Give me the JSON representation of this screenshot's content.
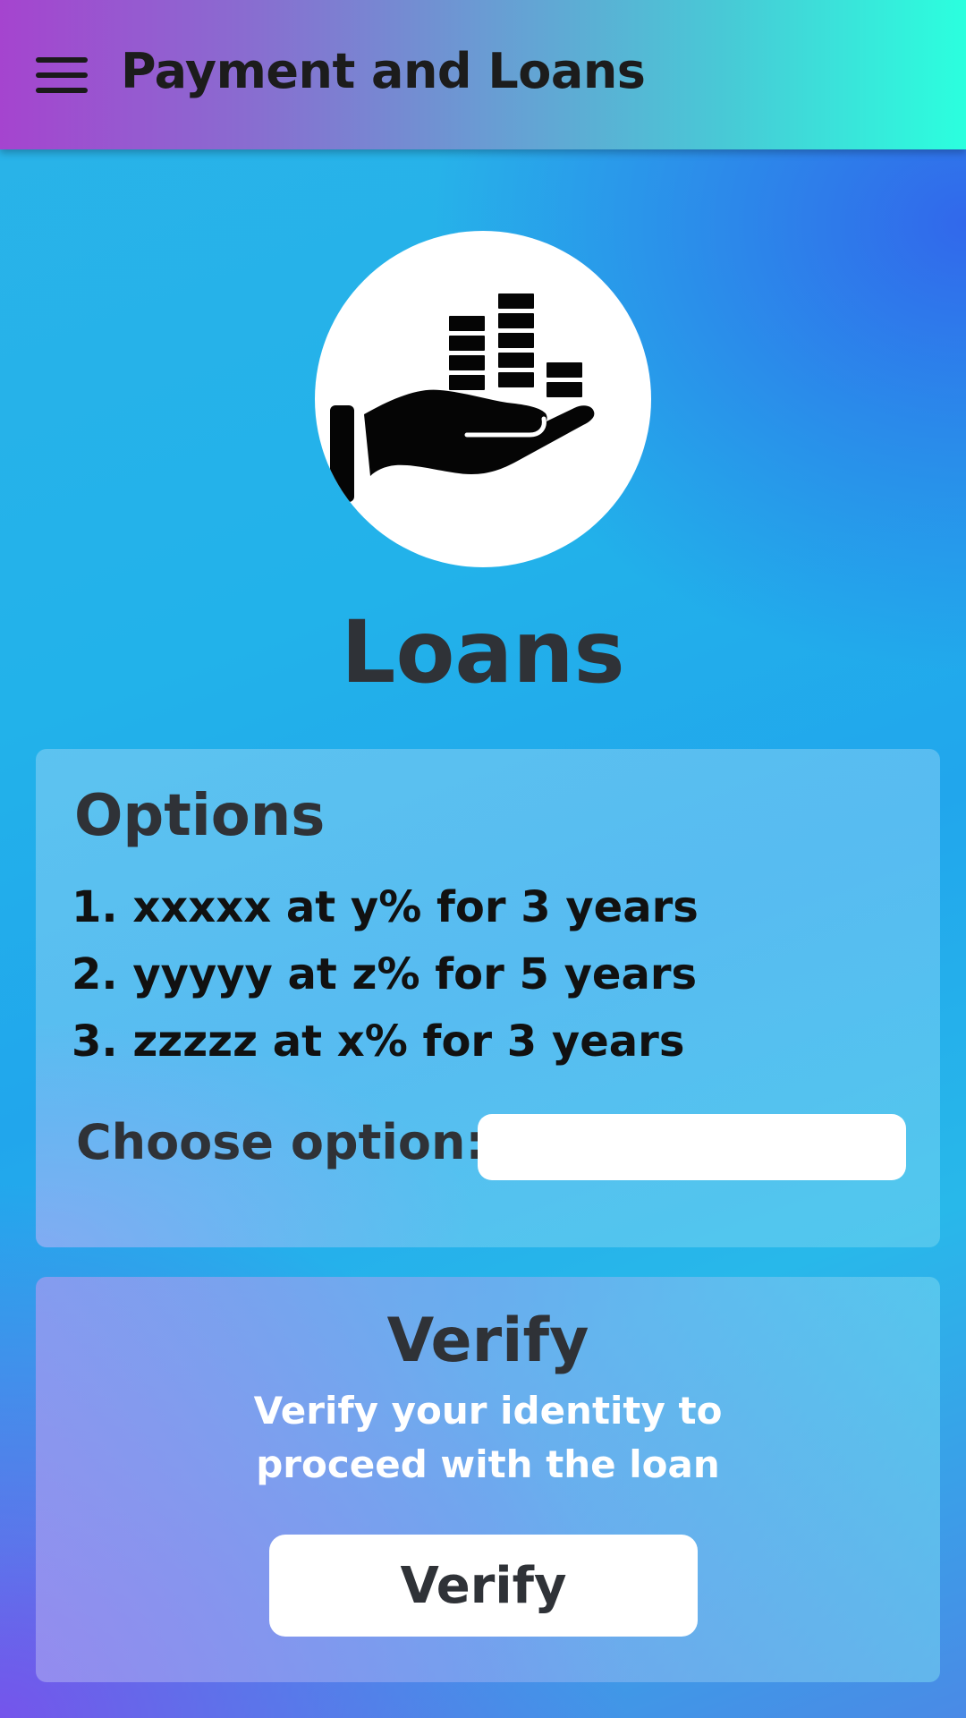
{
  "app_bar": {
    "title": "Payment and Loans",
    "menu_icon": "hamburger-menu-icon"
  },
  "hero": {
    "icon": "hand-holding-coins-icon"
  },
  "page": {
    "heading": "Loans"
  },
  "options_card": {
    "title": "Options",
    "items": [
      "1. xxxxx at y% for 3 years",
      "2. yyyyy at z% for 5 years",
      "3. zzzzz at x% for 3 years"
    ],
    "choose_label": "Choose option:",
    "choose_value": "",
    "choose_placeholder": ""
  },
  "verify_card": {
    "title": "Verify",
    "description_line1": "Verify your identity to",
    "description_line2": "proceed with the loan",
    "button_label": "Verify"
  },
  "colors": {
    "app_bar_start": "#a544cf",
    "app_bar_end": "#2bffde",
    "background": "#22b2ea",
    "heading_text": "#2f3237"
  }
}
